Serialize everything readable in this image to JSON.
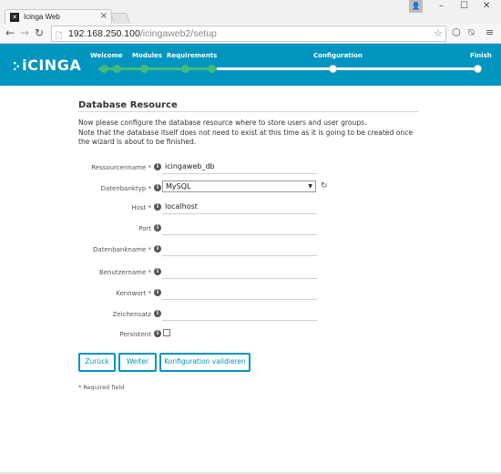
{
  "browser": {
    "tab_title": "Icinga Web",
    "tab_close": "×",
    "url_host": "192.168.250.100",
    "url_path": "/icingaweb2/setup",
    "window_controls": {
      "minimize": "–",
      "maximize": "☐",
      "close": "✕"
    },
    "nav": {
      "back": "←",
      "forward": "→",
      "reload": "↻"
    }
  },
  "header": {
    "logo_text": "iCINGA",
    "logo_dots": "⁚·",
    "steps": [
      "Welcome",
      "Modules",
      "Requirements",
      "Configuration",
      "Finish"
    ],
    "accent_color": "#0095bf",
    "done_color": "#44bb77"
  },
  "form": {
    "title": "Database Resource",
    "intro_line1": "Now please configure the database resource where to store users and user groups.",
    "intro_line2": "Note that the database itself does not need to exist at this time as it is going to be created once the wizard is about to be finished.",
    "fields": [
      {
        "label": "Ressourcenname *",
        "value": "icingaweb_db"
      },
      {
        "label": "Datenbanktyp *",
        "value": "MySQL"
      },
      {
        "label": "Host *",
        "value": "localhost"
      },
      {
        "label": "Port",
        "value": ""
      },
      {
        "label": "Datenbankname *",
        "value": ""
      },
      {
        "label": "Benutzername *",
        "value": ""
      },
      {
        "label": "Kennwort *",
        "value": ""
      },
      {
        "label": "Zeichensatz",
        "value": ""
      },
      {
        "label": "Persistent",
        "value": ""
      }
    ],
    "buttons": {
      "back": "Zurück",
      "next": "Weiter",
      "validate": "Konfiguration validieren"
    },
    "required_note": "* Required field"
  }
}
